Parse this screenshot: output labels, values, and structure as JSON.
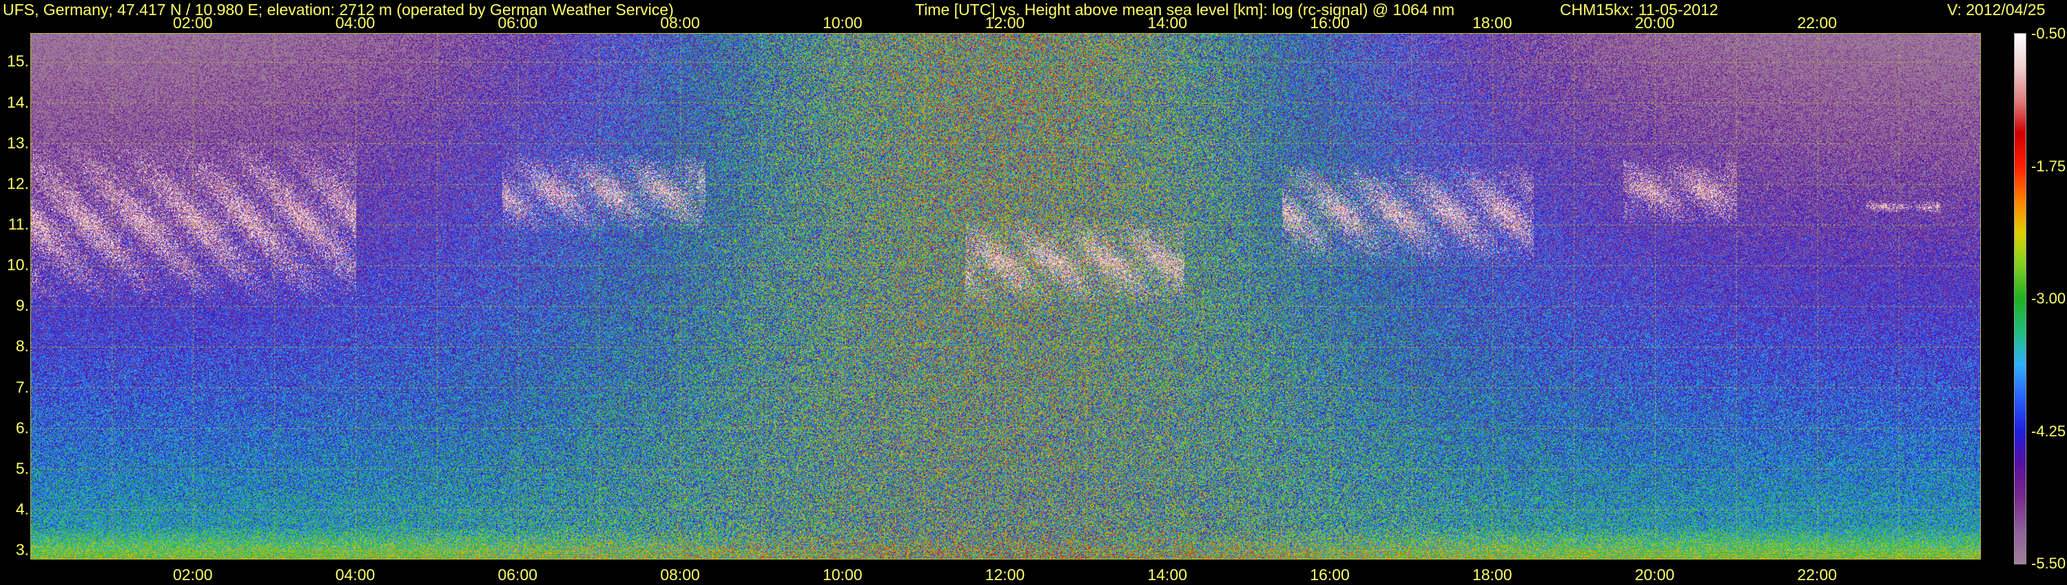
{
  "header": {
    "station": "UFS, Germany; 47.417 N / 10.980 E; elevation: 2712 m  (operated by German Weather Service)",
    "axis_title": "Time [UTC] vs. Height above mean sea level [km]: log (rc-signal) @ 1064 nm",
    "instrument_date": "CHM15kx: 11-05-2012",
    "version": "V: 2012/04/25"
  },
  "colors": {
    "text": "#ffff66",
    "grid": "#b5b53c",
    "background": "#000000"
  },
  "chart_data": {
    "type": "heatmap",
    "xlabel": "Time [UTC]",
    "ylabel": "Height above mean sea level [km]",
    "x_range_hours": [
      0,
      24
    ],
    "ylim": [
      2.8,
      15.7
    ],
    "x_ticks": [
      "02:00",
      "04:00",
      "06:00",
      "08:00",
      "10:00",
      "12:00",
      "14:00",
      "16:00",
      "18:00",
      "20:00",
      "22:00"
    ],
    "x_tick_hours": [
      2,
      4,
      6,
      8,
      10,
      12,
      14,
      16,
      18,
      20,
      22
    ],
    "y_ticks": [
      "3.",
      "4.",
      "5.",
      "6.",
      "7.",
      "8.",
      "9.",
      "10.",
      "11.",
      "12.",
      "13.",
      "14.",
      "15."
    ],
    "y_tick_values": [
      3,
      4,
      5,
      6,
      7,
      8,
      9,
      10,
      11,
      12,
      13,
      14,
      15
    ],
    "grid": true,
    "colorbar": {
      "min": -5.5,
      "max": -0.5,
      "tick_labels": [
        "-0.50",
        "-1.75",
        "-3.00",
        "-4.25",
        "-5.50"
      ],
      "tick_values": [
        -0.5,
        -1.75,
        -3.0,
        -4.25,
        -5.5
      ],
      "colors": [
        "#a0809a",
        "#90609a",
        "#7a2a8a",
        "#5a10a0",
        "#2020e0",
        "#2a60ff",
        "#30b0ff",
        "#20c080",
        "#20b020",
        "#80d020",
        "#e0d000",
        "#ff8000",
        "#ff2000",
        "#d00000",
        "#e08080",
        "#f0d0d0",
        "#ffffff"
      ]
    },
    "cloud_layers": [
      {
        "start_hour": 0.0,
        "end_hour": 4.0,
        "base_km": 9.0,
        "top_km": 13.2
      },
      {
        "start_hour": 5.8,
        "end_hour": 8.3,
        "base_km": 10.8,
        "top_km": 12.8
      },
      {
        "start_hour": 11.5,
        "end_hour": 14.2,
        "base_km": 9.0,
        "top_km": 11.2
      },
      {
        "start_hour": 15.4,
        "end_hour": 18.5,
        "base_km": 10.0,
        "top_km": 12.6
      },
      {
        "start_hour": 19.6,
        "end_hour": 21.0,
        "base_km": 11.0,
        "top_km": 12.7
      },
      {
        "start_hour": 22.6,
        "end_hour": 23.5,
        "base_km": 11.3,
        "top_km": 11.6
      }
    ]
  }
}
